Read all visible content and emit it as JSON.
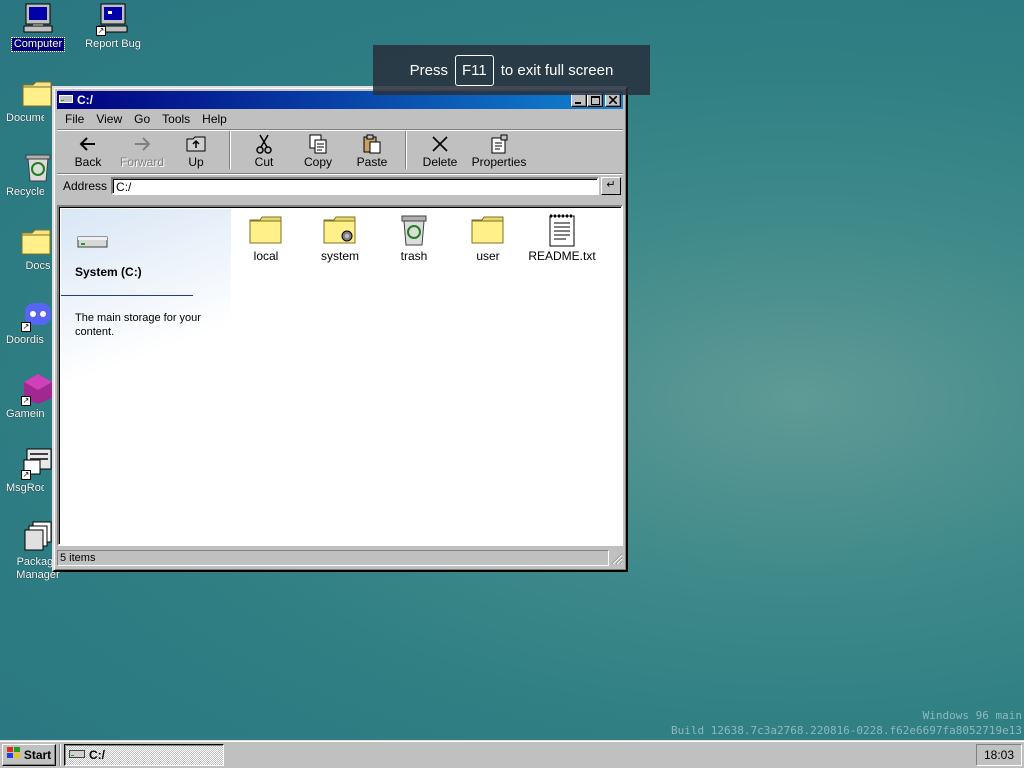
{
  "desktop": {
    "icons": [
      {
        "label": "Computer",
        "icon": "computer-icon"
      },
      {
        "label": "Report Bug",
        "icon": "report-bug-icon"
      },
      {
        "label": "Documents",
        "icon": "folder-icon"
      },
      {
        "label": "Recycle",
        "icon": "recycle-bin-icon"
      },
      {
        "label": "Docs",
        "icon": "folder-icon"
      },
      {
        "label": "Doordis",
        "icon": "discord-icon"
      },
      {
        "label": "Gameing",
        "icon": "game-icon"
      },
      {
        "label": "MsgRoom",
        "icon": "msgroom-icon"
      },
      {
        "label": "Package Manager",
        "icon": "package-manager-icon"
      }
    ]
  },
  "fullscreen_notice": {
    "before": "Press",
    "key": "F11",
    "after": "to exit full screen"
  },
  "window": {
    "title": "C:/",
    "menu": [
      "File",
      "View",
      "Go",
      "Tools",
      "Help"
    ],
    "toolbar": {
      "back": "Back",
      "forward": "Forward",
      "up": "Up",
      "cut": "Cut",
      "copy": "Copy",
      "paste": "Paste",
      "delete": "Delete",
      "properties": "Properties"
    },
    "address": {
      "label": "Address",
      "value": "C:/"
    },
    "sidepanel": {
      "title": "System (C:)",
      "description": "The main storage for your content."
    },
    "files": [
      {
        "name": "local",
        "icon": "folder-icon"
      },
      {
        "name": "system",
        "icon": "system-folder-icon"
      },
      {
        "name": "trash",
        "icon": "recycle-bin-icon"
      },
      {
        "name": "user",
        "icon": "folder-icon"
      },
      {
        "name": "README.txt",
        "icon": "text-file-icon"
      }
    ],
    "status": "5 items"
  },
  "watermark": {
    "line1": "Windows 96 main",
    "line2": "Build 12638.7c3a2768.220816-0228.f62e6697fa8052719e13"
  },
  "taskbar": {
    "start_label": "Start",
    "task_label": "C:/",
    "clock": "18:03"
  },
  "colors": {
    "titlebar": "#000080",
    "desktop": "#3f8a8a",
    "face": "#c0c0c0"
  }
}
